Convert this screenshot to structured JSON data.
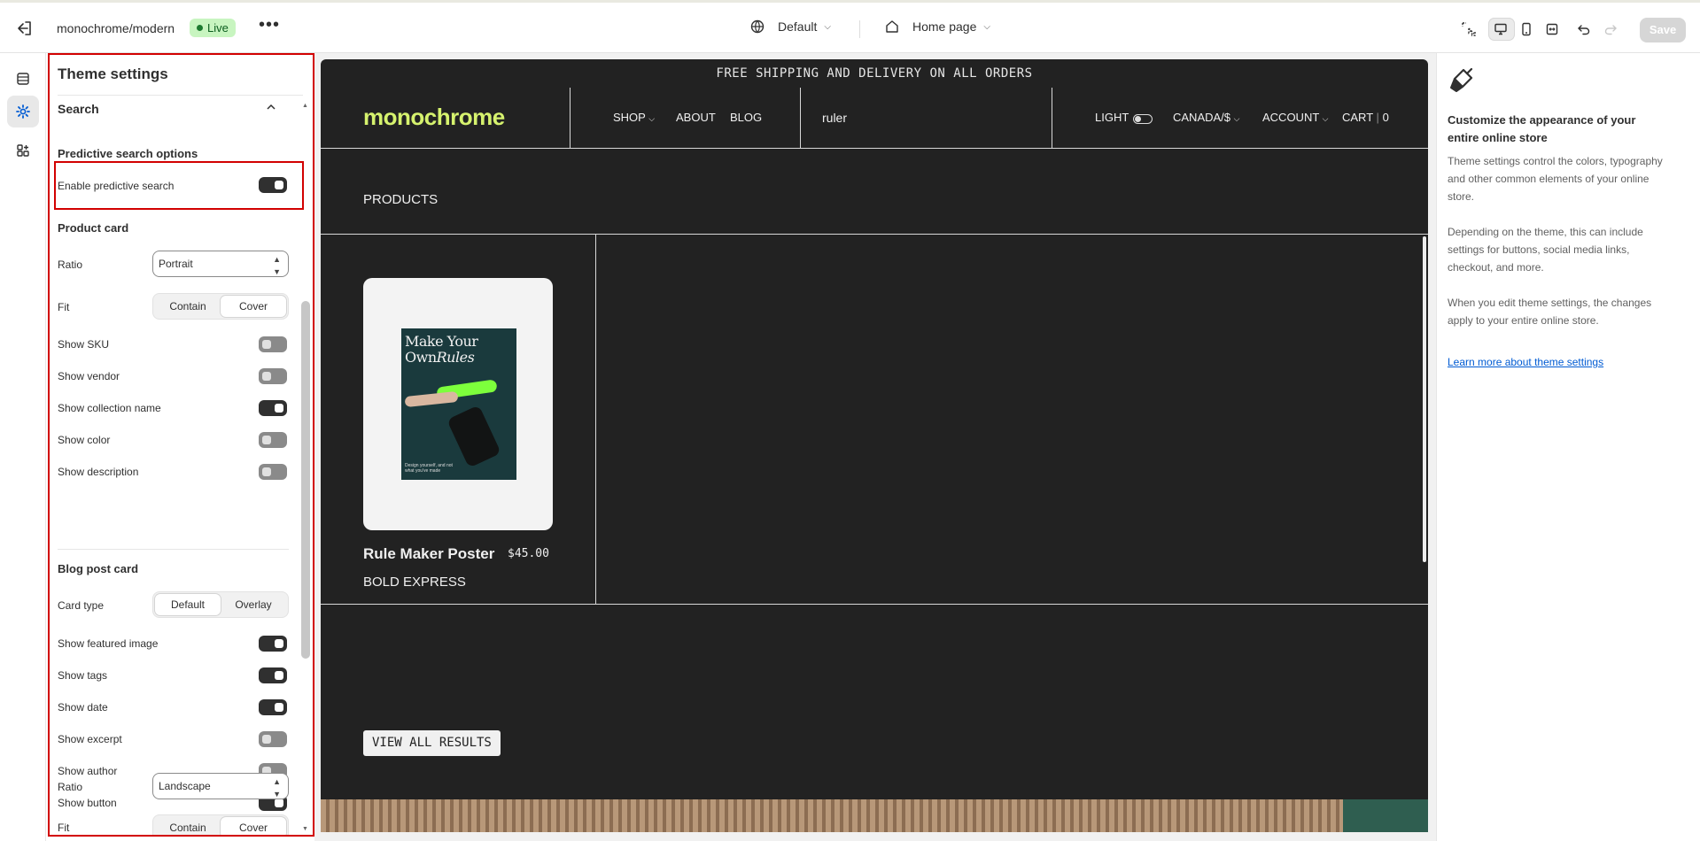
{
  "topbar": {
    "store_name": "monochrome/modern",
    "live_badge": "Live",
    "more_glyph": "•••",
    "theme_select": "Default",
    "page_select": "Home page",
    "save_label": "Save",
    "icons": [
      "exit-icon",
      "globe-icon",
      "home-icon",
      "inspector-icon",
      "desktop-icon",
      "mobile-icon",
      "fullwidth-icon",
      "undo-icon",
      "redo-icon"
    ]
  },
  "rail": {
    "items": [
      "sections-icon",
      "theme-settings-icon",
      "apps-icon"
    ],
    "active": "theme-settings-icon"
  },
  "panel": {
    "title": "Theme settings",
    "section": "Search",
    "predictive": {
      "heading": "Predictive search options",
      "label": "Enable predictive search",
      "on": true
    },
    "product_card": {
      "heading": "Product card",
      "ratio_label": "Ratio",
      "ratio_value": "Portrait",
      "fit_label": "Fit",
      "fit_options": [
        "Contain",
        "Cover"
      ],
      "fit_selected": "Cover",
      "toggles": [
        {
          "label": "Show SKU",
          "on": false
        },
        {
          "label": "Show vendor",
          "on": false
        },
        {
          "label": "Show collection name",
          "on": true
        },
        {
          "label": "Show color",
          "on": false
        },
        {
          "label": "Show description",
          "on": false
        }
      ]
    },
    "blog_card": {
      "heading": "Blog post card",
      "card_type_label": "Card type",
      "card_type_options": [
        "Default",
        "Overlay"
      ],
      "card_type_selected": "Default",
      "toggles": [
        {
          "label": "Show featured image",
          "on": true
        },
        {
          "label": "Show tags",
          "on": true
        },
        {
          "label": "Show date",
          "on": true
        },
        {
          "label": "Show excerpt",
          "on": false
        },
        {
          "label": "Show author",
          "on": false
        },
        {
          "label": "Show button",
          "on": true
        }
      ],
      "ratio_label": "Ratio",
      "ratio_value": "Landscape",
      "fit_label": "Fit",
      "fit_options": [
        "Contain",
        "Cover"
      ],
      "fit_selected": "Cover"
    }
  },
  "preview": {
    "announcement": "FREE SHIPPING AND DELIVERY ON ALL ORDERS",
    "logo": "monochrome",
    "logo_color": "#d6f26e",
    "nav": [
      "SHOP",
      "ABOUT",
      "BLOG"
    ],
    "search_value": "ruler",
    "right_nav": {
      "light": "LIGHT",
      "country": "CANADA/$",
      "account": "ACCOUNT",
      "cart": "CART",
      "cart_count": "0"
    },
    "products_heading": "PRODUCTS",
    "product": {
      "poster_title_1": "Make Your",
      "poster_title_2": "Own",
      "poster_title_3": "Rules",
      "poster_small": "Design yourself, and not what you've made",
      "title": "Rule Maker Poster",
      "price": "$45.00",
      "vendor": "BOLD EXPRESS"
    },
    "view_all": "VIEW ALL RESULTS"
  },
  "info": {
    "title": "Customize the appearance of your entire online store",
    "p1": "Theme settings control the colors, typography and other common elements of your online store.",
    "p2": "Depending on the theme, this can include settings for buttons, social media links, checkout, and more.",
    "p3": "When you edit theme settings, the changes apply to your entire online store.",
    "link": "Learn more about theme settings"
  }
}
